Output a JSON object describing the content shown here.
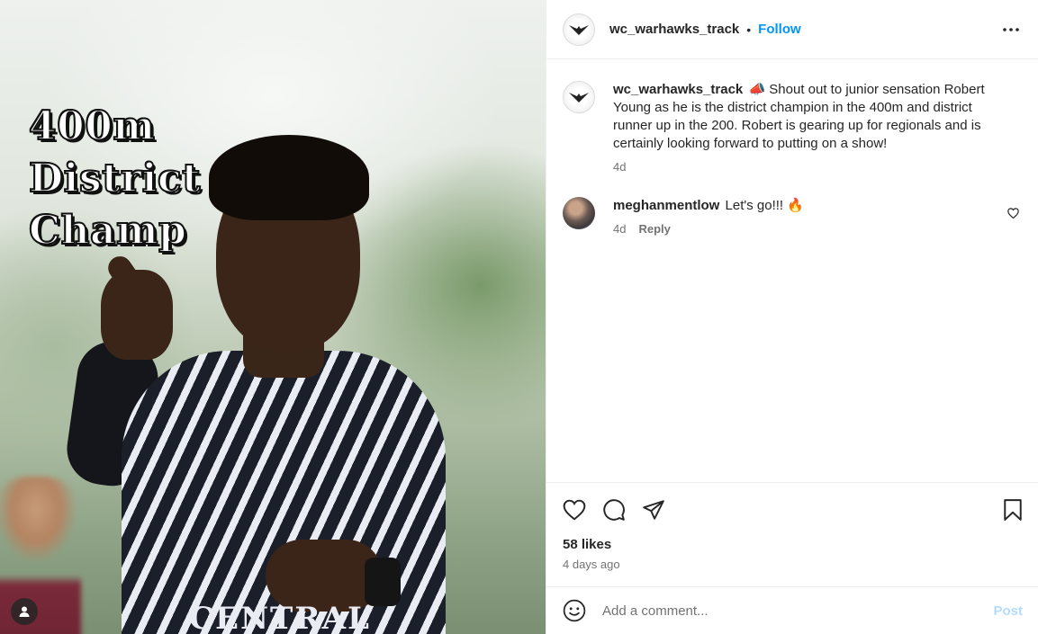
{
  "media": {
    "overlay_lines": [
      "400m",
      "District",
      "Champ"
    ],
    "jersey_text": "CENTRAL"
  },
  "header": {
    "username": "wc_warhawks_track",
    "separator": "•",
    "follow_label": "Follow",
    "more_icon": "more-horizontal-icon"
  },
  "caption": {
    "username": "wc_warhawks_track",
    "emoji": "📣",
    "text": "Shout out to junior sensation Robert Young as he is the district champion in the 400m and district runner up in the 200. Robert is gearing up for regionals and is certainly looking forward to putting on a show!",
    "time": "4d"
  },
  "comments": [
    {
      "username": "meghanmentlow",
      "text": "Let's go!!! 🔥",
      "time": "4d",
      "reply_label": "Reply"
    }
  ],
  "actions": {
    "icons": [
      "heart-icon",
      "comment-icon",
      "share-icon",
      "bookmark-icon"
    ],
    "likes": "58 likes",
    "date": "4 days ago"
  },
  "add_comment": {
    "placeholder": "Add a comment...",
    "post_label": "Post"
  },
  "colors": {
    "link": "#0095f6",
    "post_disabled": "#b3dbff",
    "secondary_text": "#737373"
  }
}
